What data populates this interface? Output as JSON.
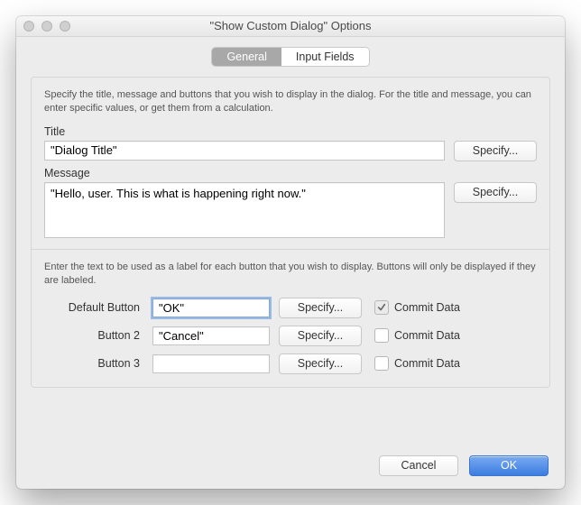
{
  "window": {
    "title": "\"Show Custom Dialog\" Options"
  },
  "tabs": {
    "general": "General",
    "input_fields": "Input Fields"
  },
  "help1": "Specify the title, message and buttons that you wish to display in the dialog. For the title and message, you can enter specific values, or get them from a calculation.",
  "title_section": {
    "label": "Title",
    "value": "\"Dialog Title\"",
    "specify": "Specify..."
  },
  "message_section": {
    "label": "Message",
    "value": "\"Hello, user. This is what is happening right now.\"",
    "specify": "Specify..."
  },
  "help2": "Enter the text to be used as a label for each button that you wish to display. Buttons will only be displayed if they are labeled.",
  "buttons_grid": {
    "specify": "Specify...",
    "commit_label": "Commit Data",
    "rows": [
      {
        "label": "Default Button",
        "value": "\"OK\"",
        "commit": true,
        "selected": true
      },
      {
        "label": "Button 2",
        "value": "\"Cancel\"",
        "commit": false,
        "selected": false
      },
      {
        "label": "Button 3",
        "value": "",
        "commit": false,
        "selected": false
      }
    ]
  },
  "footer": {
    "cancel": "Cancel",
    "ok": "OK"
  }
}
